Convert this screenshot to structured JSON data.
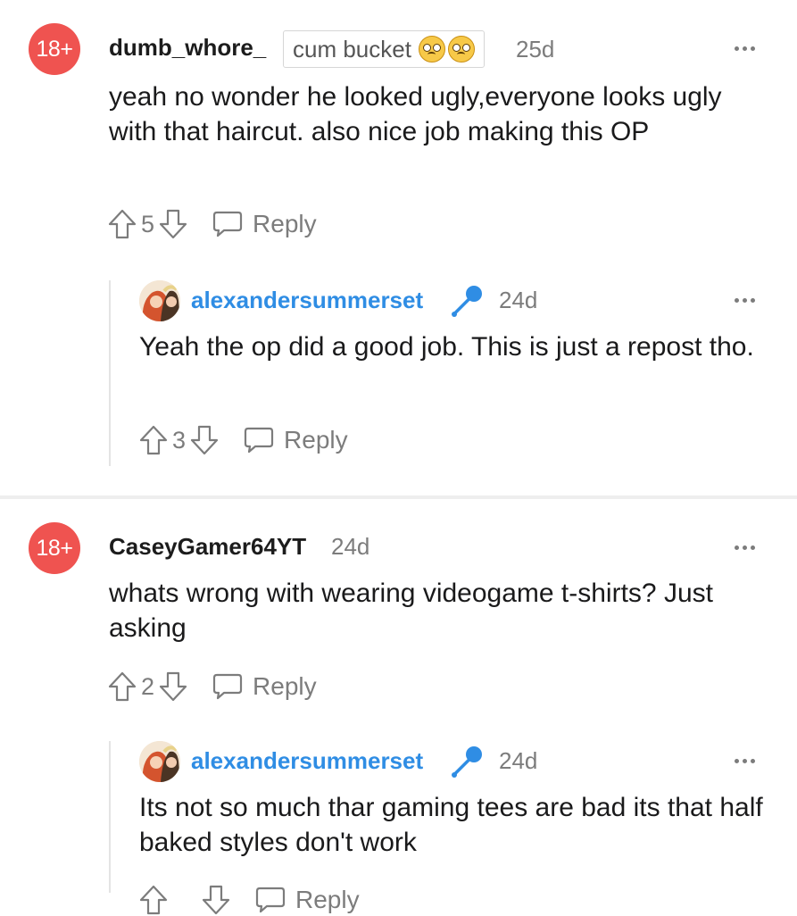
{
  "comments": [
    {
      "badge": "18+",
      "username": "dumb_whore_",
      "flair": "cum bucket",
      "flair_emoji": [
        "pleading-face-emoji",
        "pleading-face-emoji"
      ],
      "age": "25d",
      "body": "yeah no wonder he looked ugly,everyone looks ugly with that haircut. also nice job making this OP",
      "score": "5",
      "reply_label": "Reply",
      "replies": [
        {
          "username": "alexandersummerset",
          "user_icon": "microphone-icon",
          "age": "24d",
          "body": "Yeah the op did a good job. This is just a repost tho.",
          "score": "3",
          "reply_label": "Reply"
        }
      ]
    },
    {
      "badge": "18+",
      "username": "CaseyGamer64YT",
      "age": "24d",
      "body": "whats wrong with wearing videogame t-shirts? Just asking",
      "score": "2",
      "reply_label": "Reply",
      "replies": [
        {
          "username": "alexandersummerset",
          "user_icon": "microphone-icon",
          "age": "24d",
          "body": "Its not so much thar gaming tees are bad its that half baked styles don't work",
          "score": "",
          "reply_label": "Reply"
        }
      ]
    }
  ],
  "colors": {
    "badge": "#ef5350",
    "link_user": "#2f8de4",
    "muted": "#7c7c7c",
    "text": "#1a1a1b"
  }
}
